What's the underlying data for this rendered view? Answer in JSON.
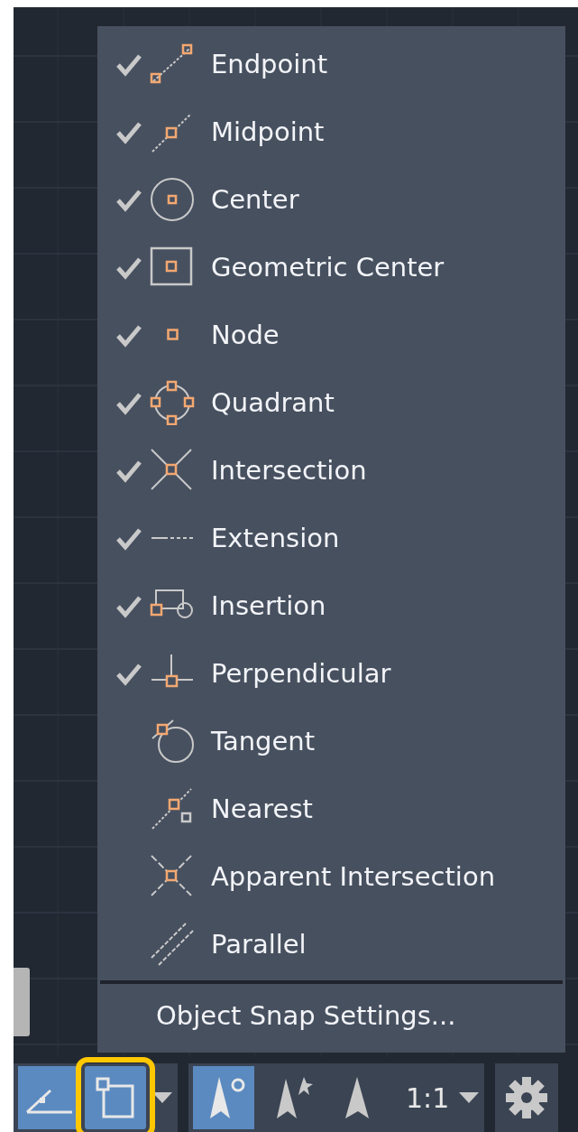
{
  "menu": {
    "items": [
      {
        "kind": "endpoint",
        "label": "Endpoint",
        "checked": true
      },
      {
        "kind": "midpoint",
        "label": "Midpoint",
        "checked": true
      },
      {
        "kind": "center",
        "label": "Center",
        "checked": true
      },
      {
        "kind": "geocenter",
        "label": "Geometric Center",
        "checked": true
      },
      {
        "kind": "node",
        "label": "Node",
        "checked": true
      },
      {
        "kind": "quadrant",
        "label": "Quadrant",
        "checked": true
      },
      {
        "kind": "intersection",
        "label": "Intersection",
        "checked": true
      },
      {
        "kind": "extension",
        "label": "Extension",
        "checked": true
      },
      {
        "kind": "insertion",
        "label": "Insertion",
        "checked": true
      },
      {
        "kind": "perpendicular",
        "label": "Perpendicular",
        "checked": true
      },
      {
        "kind": "tangent",
        "label": "Tangent",
        "checked": false
      },
      {
        "kind": "nearest",
        "label": "Nearest",
        "checked": false
      },
      {
        "kind": "apparent",
        "label": "Apparent Intersection",
        "checked": false
      },
      {
        "kind": "parallel",
        "label": "Parallel",
        "checked": false
      }
    ],
    "settings": "Object Snap Settings..."
  },
  "status_bar": {
    "groups": [
      [
        {
          "kind": "polar",
          "on": true,
          "highlighted": false
        },
        {
          "kind": "osnap",
          "on": true,
          "highlighted": true
        },
        {
          "kind": "caret"
        }
      ],
      [
        {
          "kind": "annovis",
          "on": true
        },
        {
          "kind": "autoscale",
          "on": false
        },
        {
          "kind": "annoscale",
          "on": false
        },
        {
          "kind": "scale",
          "label": "1:1"
        },
        {
          "kind": "caret"
        }
      ],
      [
        {
          "kind": "gear"
        }
      ]
    ]
  }
}
